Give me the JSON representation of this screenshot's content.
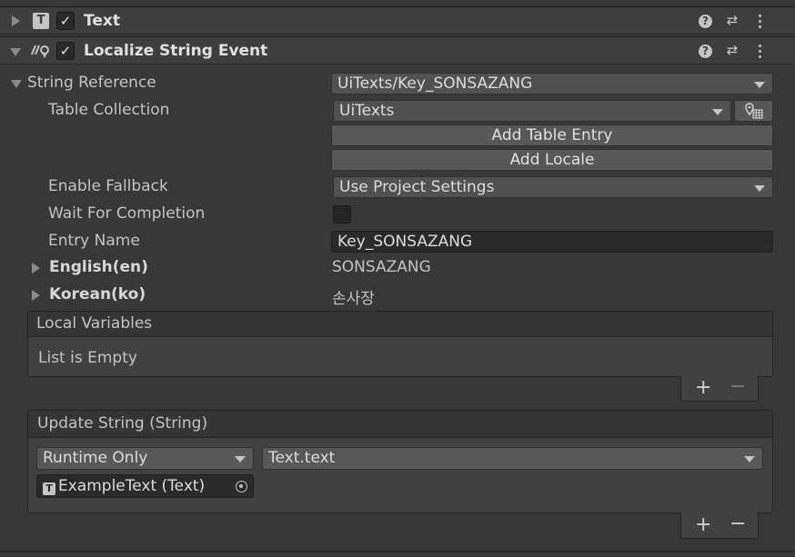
{
  "components": [
    {
      "title": "Text",
      "icon": "T",
      "enabled": true,
      "expanded": false
    },
    {
      "title": "Localize String Event",
      "enabled": true,
      "expanded": true
    }
  ],
  "string_reference": {
    "label": "String Reference",
    "value": "UiTexts/Key_SONSAZANG",
    "table_collection": {
      "label": "Table Collection",
      "value": "UiTexts"
    },
    "add_table_entry": "Add Table Entry",
    "add_locale": "Add Locale",
    "enable_fallback": {
      "label": "Enable Fallback",
      "value": "Use Project Settings"
    },
    "wait_for_completion": {
      "label": "Wait For Completion",
      "checked": false
    },
    "entry_name": {
      "label": "Entry Name",
      "value": "Key_SONSAZANG"
    },
    "locales": [
      {
        "label": "English(en)",
        "value": "SONSAZANG"
      },
      {
        "label": "Korean(ko)",
        "value": "손사장"
      }
    ]
  },
  "local_variables": {
    "header": "Local Variables",
    "empty_text": "List is Empty",
    "add": "+",
    "remove": "−"
  },
  "update_string": {
    "header": "Update String (String)",
    "mode": "Runtime Only",
    "function": "Text.text",
    "target": "ExampleText (Text)",
    "add": "+",
    "remove": "−"
  },
  "icons": {
    "help": "?",
    "presets": "⇄",
    "check": "✓"
  },
  "colors": {
    "background": "#383838",
    "header": "#3e3e3e",
    "dropdown": "#515151",
    "field": "#2a2a2a"
  }
}
